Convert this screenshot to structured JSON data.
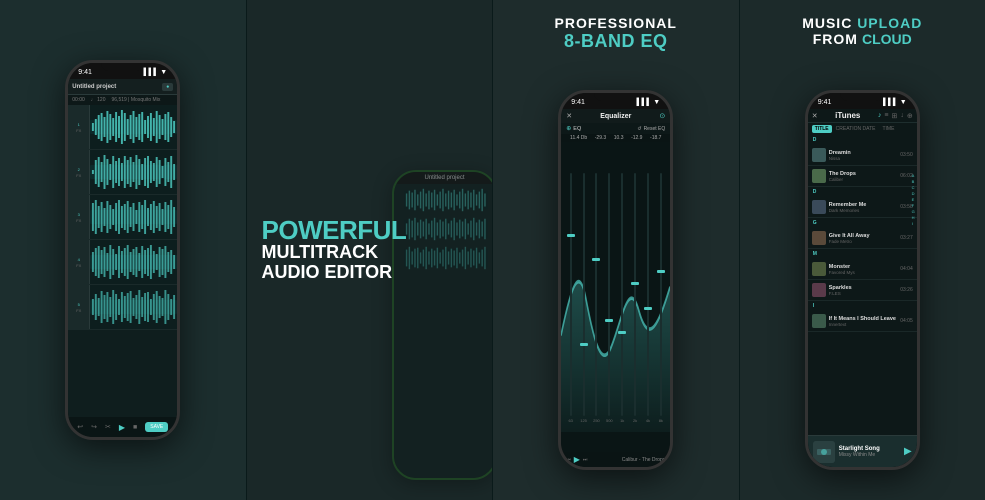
{
  "panels": [
    {
      "id": "panel1",
      "type": "multitrack",
      "phone": {
        "time": "9:41",
        "title": "Untitled project",
        "tracks": [
          {
            "label": "1",
            "color": "#4ecdc4"
          },
          {
            "label": "2",
            "color": "#4ecdc4"
          },
          {
            "label": "3",
            "color": "#4ecdc4"
          },
          {
            "label": "4",
            "color": "#4ecdc4"
          },
          {
            "label": "5",
            "color": "#4ecdc4"
          }
        ]
      }
    },
    {
      "id": "panel2",
      "type": "promo",
      "promo": {
        "line1": "POWERFUL",
        "line2": "MULTITRACK",
        "line3": "AUDIO EDITOR"
      }
    },
    {
      "id": "panel3",
      "type": "equalizer",
      "promo": {
        "line1": "PROFESSIONAL",
        "line2": "8-BAND EQ"
      },
      "phone": {
        "time": "9:41",
        "title": "Equalizer",
        "eq_label": "EQ",
        "reset_label": "Reset EQ",
        "values": [
          "11.4 Db",
          "-29.3 Db",
          "10.3 Db",
          "-12.9 Db",
          "-18.7 Db"
        ],
        "bands": [
          "63Hz",
          "125Hz",
          "250Hz",
          "500Hz",
          "1kHz",
          "2kHz",
          "4kHz",
          "8kHz"
        ],
        "sliders": [
          0.3,
          -0.7,
          0.4,
          -0.5,
          -0.6,
          0.1,
          -0.2,
          0.2
        ]
      }
    },
    {
      "id": "panel4",
      "type": "itunes",
      "promo": {
        "line1": "MUSIC UPLOAD",
        "line2": "FROM CLOUD"
      },
      "phone": {
        "time": "9:41",
        "source": "iTunes",
        "tabs": [
          "TITLE",
          "CREATION DATE",
          "TIME"
        ],
        "sections": [
          {
            "letter": "D",
            "songs": [
              {
                "title": "Dreamin",
                "artist": "Nissa",
                "duration": "03:50",
                "color": "#3a5a5a"
              },
              {
                "title": "The Drops",
                "artist": "Caliber",
                "duration": "06:02",
                "color": "#4a6a4a"
              }
            ]
          },
          {
            "letter": "D",
            "songs": [
              {
                "title": "Remember Me",
                "artist": "Dark Memories",
                "duration": "03:58",
                "color": "#3a4a5a"
              }
            ]
          },
          {
            "letter": "G",
            "songs": [
              {
                "title": "Give It All Away",
                "artist": "Fade Metro",
                "duration": "03:27",
                "color": "#5a4a3a"
              }
            ]
          },
          {
            "letter": "M",
            "songs": [
              {
                "title": "Monster",
                "artist": "Favored Mys",
                "duration": "04:04",
                "color": "#4a5a3a"
              },
              {
                "title": "Sparkles",
                "artist": "F.LES",
                "duration": "03:26",
                "color": "#5a3a4a"
              }
            ]
          },
          {
            "letter": "I",
            "songs": [
              {
                "title": "If It Means I Should Leave",
                "artist": "Innertext",
                "duration": "04:05",
                "color": "#3a5a4a"
              }
            ]
          }
        ],
        "sidebar_letters": [
          "A",
          "B",
          "C",
          "D",
          "E",
          "F",
          "G",
          "H",
          "I",
          "J",
          "K",
          "L",
          "M",
          "N"
        ],
        "now_playing": {
          "title": "Starlight Song",
          "artist": "Missy Within Me"
        }
      }
    }
  ]
}
